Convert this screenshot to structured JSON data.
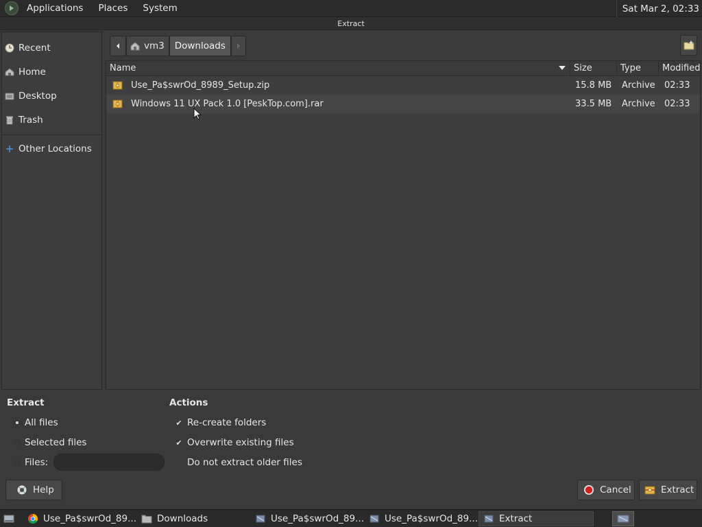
{
  "top_panel": {
    "menus": [
      "Applications",
      "Places",
      "System"
    ],
    "clock": "Sat Mar  2, 02:33"
  },
  "window": {
    "title": "Extract"
  },
  "sidebar": {
    "items": [
      {
        "label": "Recent",
        "icon": "recent-icon"
      },
      {
        "label": "Home",
        "icon": "home-icon"
      },
      {
        "label": "Desktop",
        "icon": "desktop-icon"
      },
      {
        "label": "Trash",
        "icon": "trash-icon"
      },
      {
        "label": "Other Locations",
        "icon": "plus-icon"
      }
    ]
  },
  "pathbar": {
    "segments": [
      "vm3",
      "Downloads"
    ]
  },
  "filelist": {
    "columns": {
      "name": "Name",
      "size": "Size",
      "type": "Type",
      "modified": "Modified"
    },
    "rows": [
      {
        "name": "Use_Pa$swrOd_8989_Setup.zip",
        "size": "15.8 MB",
        "type": "Archive",
        "modified": "02:33"
      },
      {
        "name": "Windows 11 UX Pack 1.0  [PeskTop.com].rar",
        "size": "33.5 MB",
        "type": "Archive",
        "modified": "02:33"
      }
    ]
  },
  "extract": {
    "title": "Extract",
    "all_files": "All files",
    "selected_files": "Selected files",
    "files_label": "Files:",
    "files_value": ""
  },
  "actions": {
    "title": "Actions",
    "recreate": "Re-create folders",
    "overwrite": "Overwrite existing files",
    "no_older": "Do not extract older files"
  },
  "buttons": {
    "help": "Help",
    "cancel": "Cancel",
    "extract": "Extract"
  },
  "taskbar": {
    "tasks": [
      {
        "label": "Use_Pa$swrOd_89...",
        "icon": "chrome-icon"
      },
      {
        "label": "Downloads",
        "icon": "folder-icon"
      },
      {
        "label": "Use_Pa$swrOd_89...",
        "icon": "archive-icon"
      },
      {
        "label": "Use_Pa$swrOd_89...",
        "icon": "archive-icon"
      },
      {
        "label": "Extract",
        "icon": "archive-icon"
      }
    ]
  }
}
